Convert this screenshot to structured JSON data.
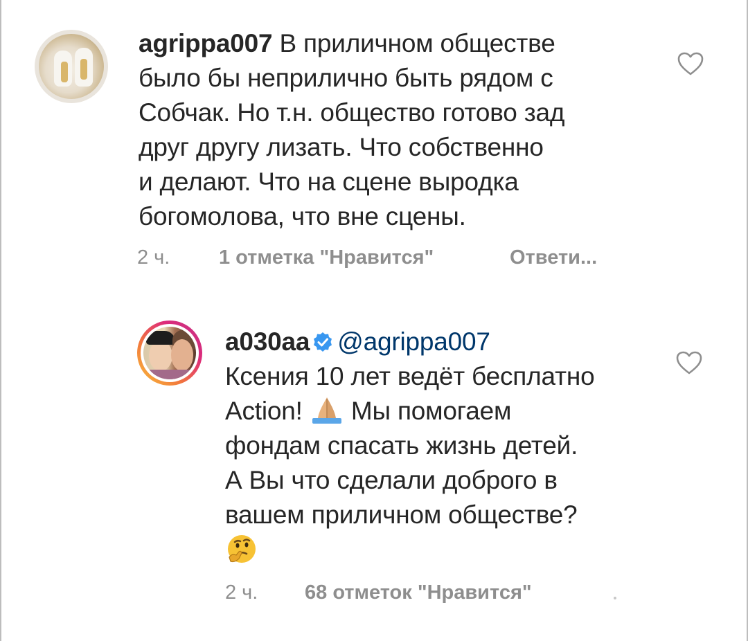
{
  "comments": [
    {
      "username": "agrippa007",
      "text_lines": [
        " В приличном обществе",
        "было бы неприлично быть рядом с",
        "Собчак. Но т.н. общество готово зад",
        "друг другу лизать. Что собственно",
        "и делают. Что на сцене выродка",
        "богомолова, что вне сцены."
      ],
      "time": "2 ч.",
      "likes": "1 отметка \"Нравится\"",
      "reply": "Ответи..."
    },
    {
      "username": "a030aa",
      "mention": "@agrippa007",
      "text_lines": [
        "Ксения 10 лет ведёт бесплатно",
        "Action! ",
        " Мы помогаем",
        "фондам спасать жизнь детей.",
        "А Вы что сделали доброго в",
        "вашем приличном обществе?"
      ],
      "time": "2 ч.",
      "likes": "68 отметок \"Нравится\""
    }
  ],
  "icons": {
    "like": "heart-outline-icon",
    "verified": "verified-badge-icon",
    "pray_emoji": "folded-hands-emoji",
    "thinking_emoji": "thinking-face-emoji"
  },
  "colors": {
    "text": "#262626",
    "meta": "#8e8e8e",
    "mention": "#00376b",
    "verified": "#3897f0"
  }
}
